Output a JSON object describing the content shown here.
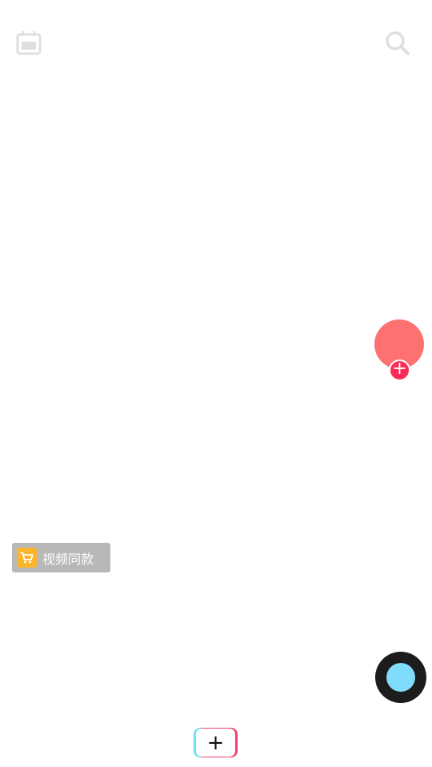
{
  "top_bar": {
    "left_icon": "live-calendar-icon",
    "right_icon": "search-icon"
  },
  "side_actions": {
    "avatar_color": "#fd7171",
    "follow_symbol": "+",
    "follow_color": "#fe2c55"
  },
  "product_tag": {
    "label": "视频同款",
    "icon": "shopping-cart-icon",
    "icon_color": "#fbb52c"
  },
  "music": {
    "disc_color": "#1c1c1c",
    "cover_color": "#7fdcfb"
  },
  "bottom_bar": {
    "create_symbol": "+"
  }
}
